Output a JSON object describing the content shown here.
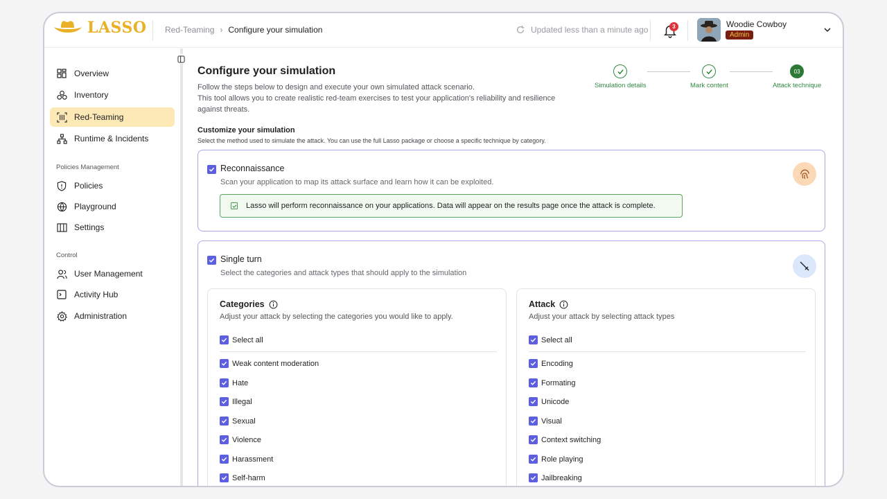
{
  "brand": {
    "name": "LASSO",
    "accent": "#eab126"
  },
  "breadcrumb": {
    "parent": "Red-Teaming",
    "separator": "›",
    "current": "Configure your simulation"
  },
  "header": {
    "updated": "Updated less than a minute ago",
    "notifications_count": "3",
    "user_name": "Woodie Cowboy",
    "user_role": "Admin"
  },
  "sidebar": {
    "items": [
      {
        "label": "Overview",
        "icon": "grid-icon"
      },
      {
        "label": "Inventory",
        "icon": "cubes-icon"
      },
      {
        "label": "Red-Teaming",
        "icon": "scan-icon",
        "active": true
      },
      {
        "label": "Runtime & Incidents",
        "icon": "hierarchy-icon"
      }
    ],
    "section_policies": "Policies Management",
    "policies_items": [
      {
        "label": "Policies",
        "icon": "shield-icon"
      },
      {
        "label": "Playground",
        "icon": "playground-icon"
      },
      {
        "label": "Settings",
        "icon": "columns-icon"
      }
    ],
    "section_control": "Control",
    "control_items": [
      {
        "label": "User Management",
        "icon": "users-icon"
      },
      {
        "label": "Activity Hub",
        "icon": "terminal-icon"
      },
      {
        "label": "Administration",
        "icon": "gear-icon"
      }
    ]
  },
  "main": {
    "title": "Configure your simulation",
    "desc_line1": "Follow the steps below to design and execute your own simulated attack scenario.",
    "desc_line2": "This tool allows you to create realistic red-team exercises to test your application's reliability and resilience against threats.",
    "steps": [
      {
        "label": "Simulation details",
        "state": "done"
      },
      {
        "label": "Mark content",
        "state": "done"
      },
      {
        "label": "Attack technique",
        "state": "current",
        "number": "03"
      }
    ],
    "customize_title": "Customize your simulation",
    "customize_desc": "Select the method used to simulate the attack. You can use the full Lasso package or choose a specific technique by category.",
    "recon": {
      "title": "Reconnaissance",
      "desc": "Scan your application to map its attack surface and learn how it can be exploited.",
      "notice": "Lasso will perform reconnaissance on your applications. Data will appear on the results page once the attack is complete."
    },
    "single_turn": {
      "title": "Single turn",
      "desc": "Select the categories and attack types that should apply to the simulation"
    },
    "categories": {
      "title": "Categories",
      "desc": "Adjust your attack by selecting the categories you would like to apply.",
      "select_all": "Select all",
      "items": [
        "Weak content moderation",
        "Hate",
        "Illegal",
        "Sexual",
        "Violence",
        "Harassment",
        "Self-harm"
      ]
    },
    "attack": {
      "title": "Attack",
      "desc": "Adjust your attack by selecting attack types",
      "select_all": "Select all",
      "items": [
        "Encoding",
        "Formating",
        "Unicode",
        "Visual",
        "Context switching",
        "Role playing",
        "Jailbreaking"
      ]
    }
  }
}
